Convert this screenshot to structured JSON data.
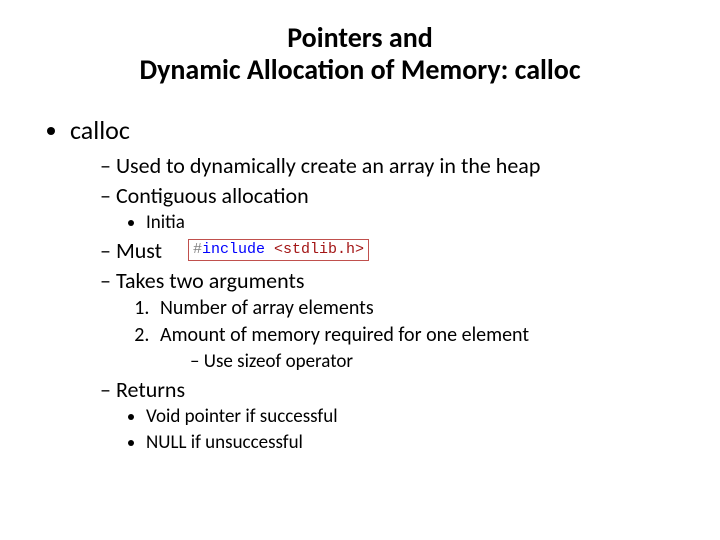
{
  "title_line1": "Pointers and",
  "title_line2": "Dynamic Allocation of Memory: calloc",
  "b1": "calloc",
  "s1": "Used to dynamically create an array in the heap",
  "s2": "Contiguous allocation",
  "s2a": "Initia",
  "s3": "Must",
  "s4": "Takes two arguments",
  "s4n1": "Number of array elements",
  "s4n2": "Amount of memory required for one element",
  "s4n2a": "Use sizeof operator",
  "s5": "Returns",
  "s5a": "Void pointer if successful",
  "s5b": "NULL if unsuccessful",
  "code": {
    "pre": "#",
    "inc": "include",
    "sp": " ",
    "hdr": "<stdlib.h>"
  }
}
